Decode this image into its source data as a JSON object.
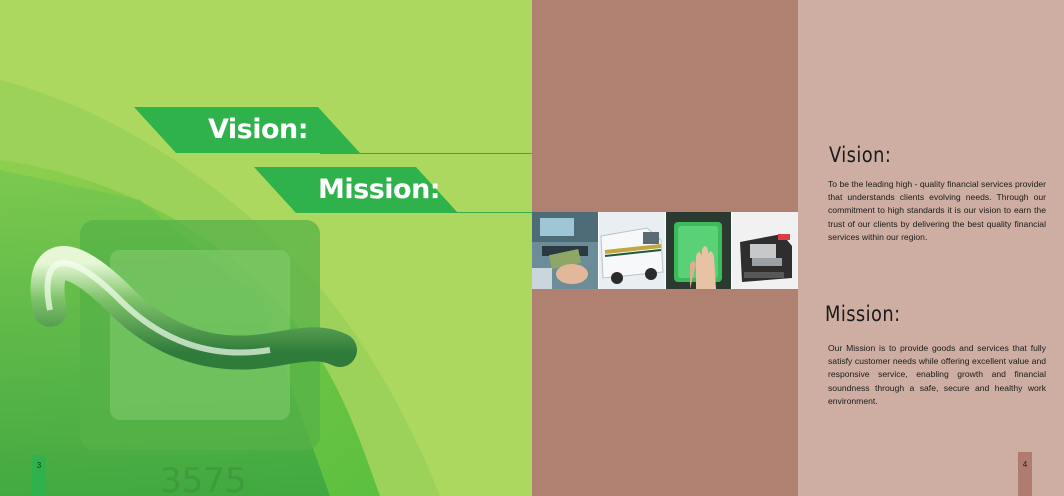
{
  "left_page": {
    "vision_banner": "Vision:",
    "mission_banner": "Mission:",
    "page_number": "3"
  },
  "right_page": {
    "vision_heading": "Vision:",
    "vision_text": "To be the leading high - quality financial services provider that understands clients evolving needs. Through our commitment to high standards it is our vision to earn the trust of our clients by delivering the best quality financial services within our region.",
    "mission_heading": "Mission:",
    "mission_text": "Our Mission is to provide goods and services that fully satisfy customer needs while offering excellent value and responsive service, enabling growth and financial soundness through a safe, secure and healthy work environment.",
    "page_number": "4"
  },
  "photos": [
    "atm-cash-photo",
    "cash-van-photo",
    "fingerprint-scanner-photo",
    "money-counter-photo"
  ],
  "colors": {
    "lime": "#add860",
    "banner_green": "#2fb24b",
    "mauve": "#b08070",
    "blush": "#ceaea2"
  }
}
